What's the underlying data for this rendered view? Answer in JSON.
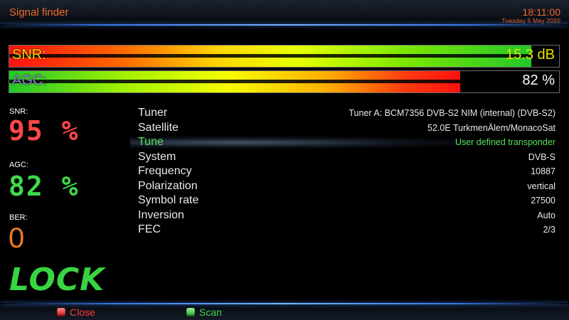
{
  "header": {
    "title": "Signal finder",
    "time": "18:11:00",
    "date": "Tuesday  5 May 2020"
  },
  "meters": {
    "snr": {
      "label": "SNR:",
      "value": "15.3 dB",
      "fill_percent": 95
    },
    "agc": {
      "label": "AGC:",
      "value": "82 %",
      "fill_percent": 82
    }
  },
  "readouts": {
    "snr": {
      "label": "SNR:",
      "value": "95 %"
    },
    "agc": {
      "label": "AGC:",
      "value": "82 %"
    },
    "ber": {
      "label": "BER:",
      "value": "0"
    },
    "lock": "LOCK"
  },
  "info": {
    "rows": [
      {
        "key": "Tuner",
        "value": "Tuner A: BCM7356 DVB-S2 NIM (internal) (DVB-S2)"
      },
      {
        "key": "Satellite",
        "value": "52.0E TurkmenÄlem/MonacoSat"
      },
      {
        "key": "Tune",
        "value": "User defined transponder"
      },
      {
        "key": "System",
        "value": "DVB-S"
      },
      {
        "key": "Frequency",
        "value": "10887"
      },
      {
        "key": "Polarization",
        "value": "vertical"
      },
      {
        "key": "Symbol rate",
        "value": "27500"
      },
      {
        "key": "Inversion",
        "value": "Auto"
      },
      {
        "key": "FEC",
        "value": "2/3"
      }
    ],
    "selected_index": 2
  },
  "footer": {
    "close_label": "Close",
    "scan_label": "Scan"
  },
  "colors": {
    "accent_orange": "#f06a2c",
    "lock_green": "#38d442",
    "snr_red": "#ff4848"
  }
}
